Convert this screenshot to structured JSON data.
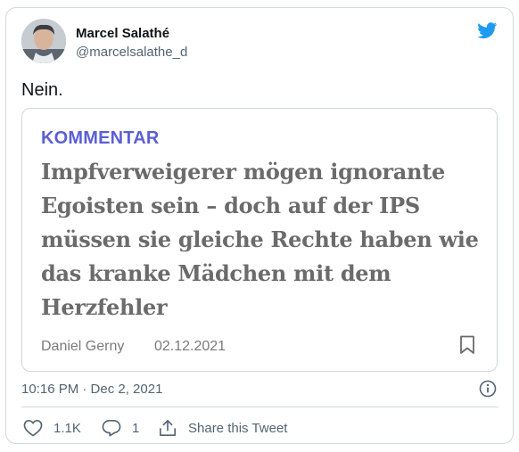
{
  "user": {
    "display_name": "Marcel Salathé",
    "handle": "@marcelsalathe_d"
  },
  "tweet": {
    "text": "Nein.",
    "timestamp": "10:16 PM · Dec 2, 2021"
  },
  "card": {
    "kicker": "KOMMENTAR",
    "title_lines": [
      "Impfverweigerer mögen ignorante",
      "Egoisten sein – doch auf der IPS",
      "müssen sie gleiche Rechte haben wie",
      "das kranke Mädchen mit dem",
      "Herzfehler"
    ],
    "author": "Daniel Gerny",
    "date": "02.12.2021"
  },
  "actions": {
    "likes": "1.1K",
    "replies": "1",
    "share_label": "Share this Tweet"
  },
  "colors": {
    "twitter_blue": "#1d9bf0",
    "kicker": "#5b5fd6",
    "secondary_text": "#536471",
    "border": "#cfd9de"
  },
  "icons": [
    "twitter-bird-icon",
    "bookmark-icon",
    "info-icon",
    "heart-icon",
    "reply-icon",
    "share-icon"
  ]
}
